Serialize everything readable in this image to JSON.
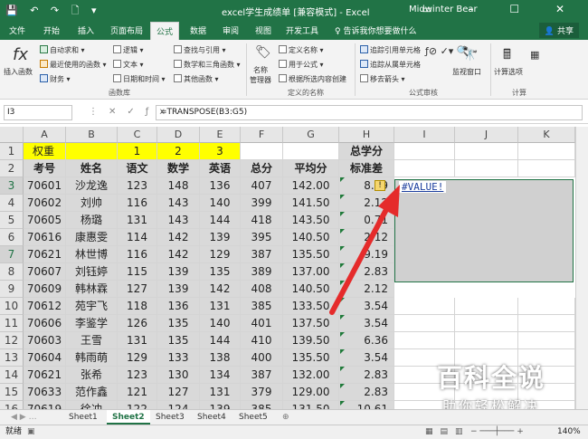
{
  "titlebar": {
    "qat": "💾 ↶ ↷ 🗋 ▾",
    "title": "excel学生成绩单 [兼容模式] - Excel",
    "user": "Midwinter Bear",
    "winctl": "▭ – ☐ ✕"
  },
  "tabs": [
    "文件",
    "开始",
    "插入",
    "页面布局",
    "公式",
    "数据",
    "审阅",
    "视图",
    "开发工具",
    "♀ 告诉我你想要做什么"
  ],
  "active_tab": "公式",
  "share": "共享",
  "ribbon": {
    "insert_fn": "插入函数",
    "g1": [
      "自动求和 ▾",
      "最近使用的函数 ▾",
      "财务 ▾"
    ],
    "g2": [
      "逻辑 ▾",
      "文本 ▾",
      "日期和时间 ▾"
    ],
    "g3": [
      "查找与引用 ▾",
      "数学和三角函数 ▾",
      "其他函数 ▾"
    ],
    "group1_label": "函数库",
    "name_mgr": "名称\n管理器",
    "g4": [
      "定义名称 ▾",
      "用于公式 ▾",
      "根据所选内容创建"
    ],
    "group2_label": "定义的名称",
    "g5": [
      "追踪引用单元格",
      "追踪从属单元格",
      "移去箭头 ▾"
    ],
    "watch": "监视窗口",
    "group3_label": "公式审核",
    "calc": "计算选项",
    "group4_label": "计算"
  },
  "namebox": "I3",
  "formula": "=TRANSPOSE(B3:G5)",
  "columns": [
    "A",
    "B",
    "C",
    "D",
    "E",
    "F",
    "G",
    "H",
    "I",
    "J",
    "K"
  ],
  "row_nums": [
    "1",
    "2",
    "3",
    "4",
    "5",
    "6",
    "7",
    "8",
    "9",
    "10",
    "11",
    "12",
    "13",
    "14",
    "15",
    "16"
  ],
  "row1": {
    "a": "权重",
    "c": "1",
    "d": "2",
    "e": "3",
    "h": "总学分"
  },
  "row2": [
    "考号",
    "姓名",
    "语文",
    "数学",
    "英语",
    "总分",
    "平均分",
    "标准差"
  ],
  "rows": [
    [
      "70601",
      "沙龙逸",
      "123",
      "148",
      "136",
      "407",
      "142.00",
      "8.49"
    ],
    [
      "70602",
      "刘帅",
      "116",
      "143",
      "140",
      "399",
      "141.50",
      "2.12"
    ],
    [
      "70605",
      "杨璐",
      "131",
      "143",
      "144",
      "418",
      "143.50",
      "0.71"
    ],
    [
      "70616",
      "康惠雯",
      "114",
      "142",
      "139",
      "395",
      "140.50",
      "2.12"
    ],
    [
      "70621",
      "林世博",
      "116",
      "142",
      "129",
      "387",
      "135.50",
      "9.19"
    ],
    [
      "70607",
      "刘钰婷",
      "115",
      "139",
      "135",
      "389",
      "137.00",
      "2.83"
    ],
    [
      "70609",
      "韩林霖",
      "127",
      "139",
      "142",
      "408",
      "140.50",
      "2.12"
    ],
    [
      "70612",
      "苑宇飞",
      "118",
      "136",
      "131",
      "385",
      "133.50",
      "3.54"
    ],
    [
      "70606",
      "李鉴学",
      "126",
      "135",
      "140",
      "401",
      "137.50",
      "3.54"
    ],
    [
      "70603",
      "王雪",
      "131",
      "135",
      "144",
      "410",
      "139.50",
      "6.36"
    ],
    [
      "70604",
      "韩雨萌",
      "129",
      "133",
      "138",
      "400",
      "135.50",
      "3.54"
    ],
    [
      "70621",
      "张希",
      "123",
      "130",
      "134",
      "387",
      "132.00",
      "2.83"
    ],
    [
      "70633",
      "范作鑫",
      "121",
      "127",
      "131",
      "379",
      "129.00",
      "2.83"
    ],
    [
      "70619",
      "徐冲",
      "122",
      "124",
      "139",
      "385",
      "131.50",
      "10.61"
    ]
  ],
  "error_value": "#VALUE!",
  "sheets": [
    "Sheet1",
    "Sheet2",
    "Sheet3",
    "Sheet4",
    "Sheet5"
  ],
  "active_sheet": "Sheet2",
  "status": "就绪",
  "zoom": "140%",
  "watermark": {
    "line1": "百科全说",
    "line2": "助你轻松解决"
  }
}
